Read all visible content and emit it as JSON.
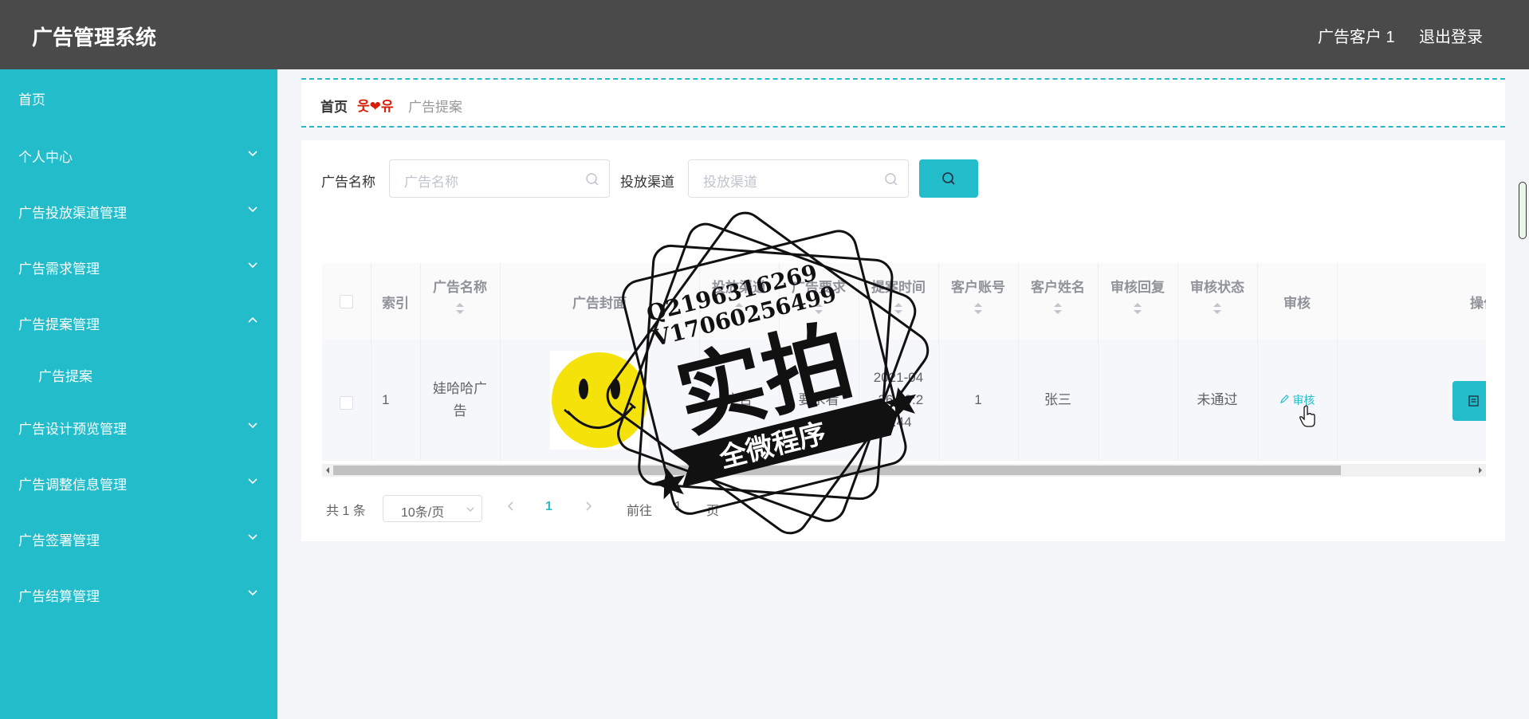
{
  "header": {
    "title": "广告管理系统",
    "user": "广告客户 1",
    "logout": "退出登录"
  },
  "sidebar": {
    "items": [
      {
        "label": "首页"
      },
      {
        "label": "个人中心"
      },
      {
        "label": "广告投放渠道管理"
      },
      {
        "label": "广告需求管理"
      },
      {
        "label": "广告提案管理"
      },
      {
        "label": "广告提案"
      },
      {
        "label": "广告设计预览管理"
      },
      {
        "label": "广告调整信息管理"
      },
      {
        "label": "广告签署管理"
      },
      {
        "label": "广告结算管理"
      }
    ]
  },
  "breadcrumb": {
    "home": "首页",
    "separator": "웃❤유",
    "current": "广告提案"
  },
  "search": {
    "name_label": "广告名称",
    "name_placeholder": "广告名称",
    "channel_label": "投放渠道",
    "channel_placeholder": "投放渠道"
  },
  "table": {
    "headers": [
      "索引",
      "广告名称",
      "广告封面",
      "投放渠道",
      "广告要求",
      "提案时间",
      "客户账号",
      "客户姓名",
      "审核回复",
      "审核状态",
      "审核",
      "操作"
    ],
    "rows": [
      {
        "index": "1",
        "name": "娃哈哈广告",
        "cover": "",
        "channel": "广告",
        "requirement": "要求看",
        "time": "2021-04-26 20:25:44",
        "account": "1",
        "customer": "张三",
        "reply": "",
        "status": "未通过",
        "audit": "审核"
      }
    ]
  },
  "pagination": {
    "total": "共 1 条",
    "page_size": "10条/页",
    "current_page": "1",
    "goto": "前往",
    "jump": "1",
    "page_unit": "页"
  },
  "watermark": {
    "line1": "Q2196316269",
    "line2": "V17060256499",
    "main": "实拍",
    "banner": "全微程序"
  },
  "colors": {
    "accent": "#23bccb",
    "topbar": "#4a4a4a"
  }
}
